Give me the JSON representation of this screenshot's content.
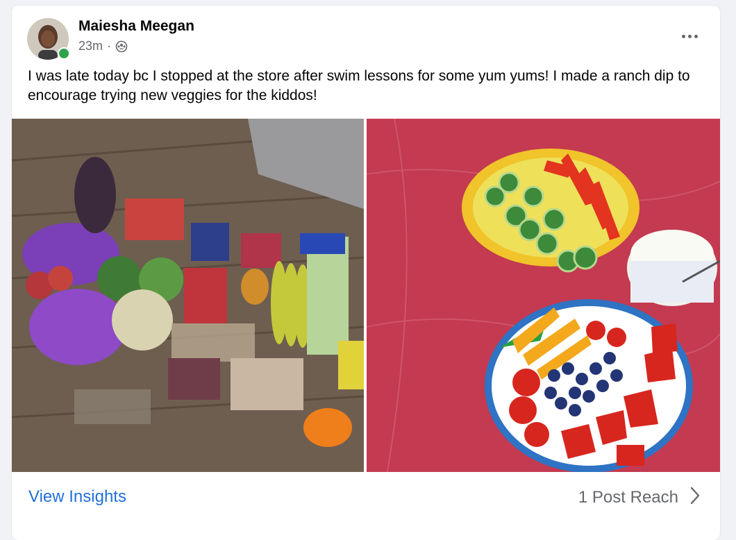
{
  "post": {
    "author": "Maiesha Meegan",
    "time": "23m",
    "separator": "·",
    "audience_icon": "group-audience-icon",
    "text": "I was late today bc I stopped at the store after swim lessons for some yum yums! I made a ranch dip to encourage trying new veggies for the kiddos!",
    "online": true
  },
  "photos": {
    "left_icon": "groceries-photo",
    "right_icon": "veggie-fruit-plates-photo"
  },
  "footer": {
    "insights_label": "View Insights",
    "reach_label": "1 Post Reach",
    "chevron_icon": "chevron-right-icon"
  },
  "colors": {
    "link": "#216fdb",
    "secondary_text": "#65676b",
    "online": "#31a24c"
  }
}
